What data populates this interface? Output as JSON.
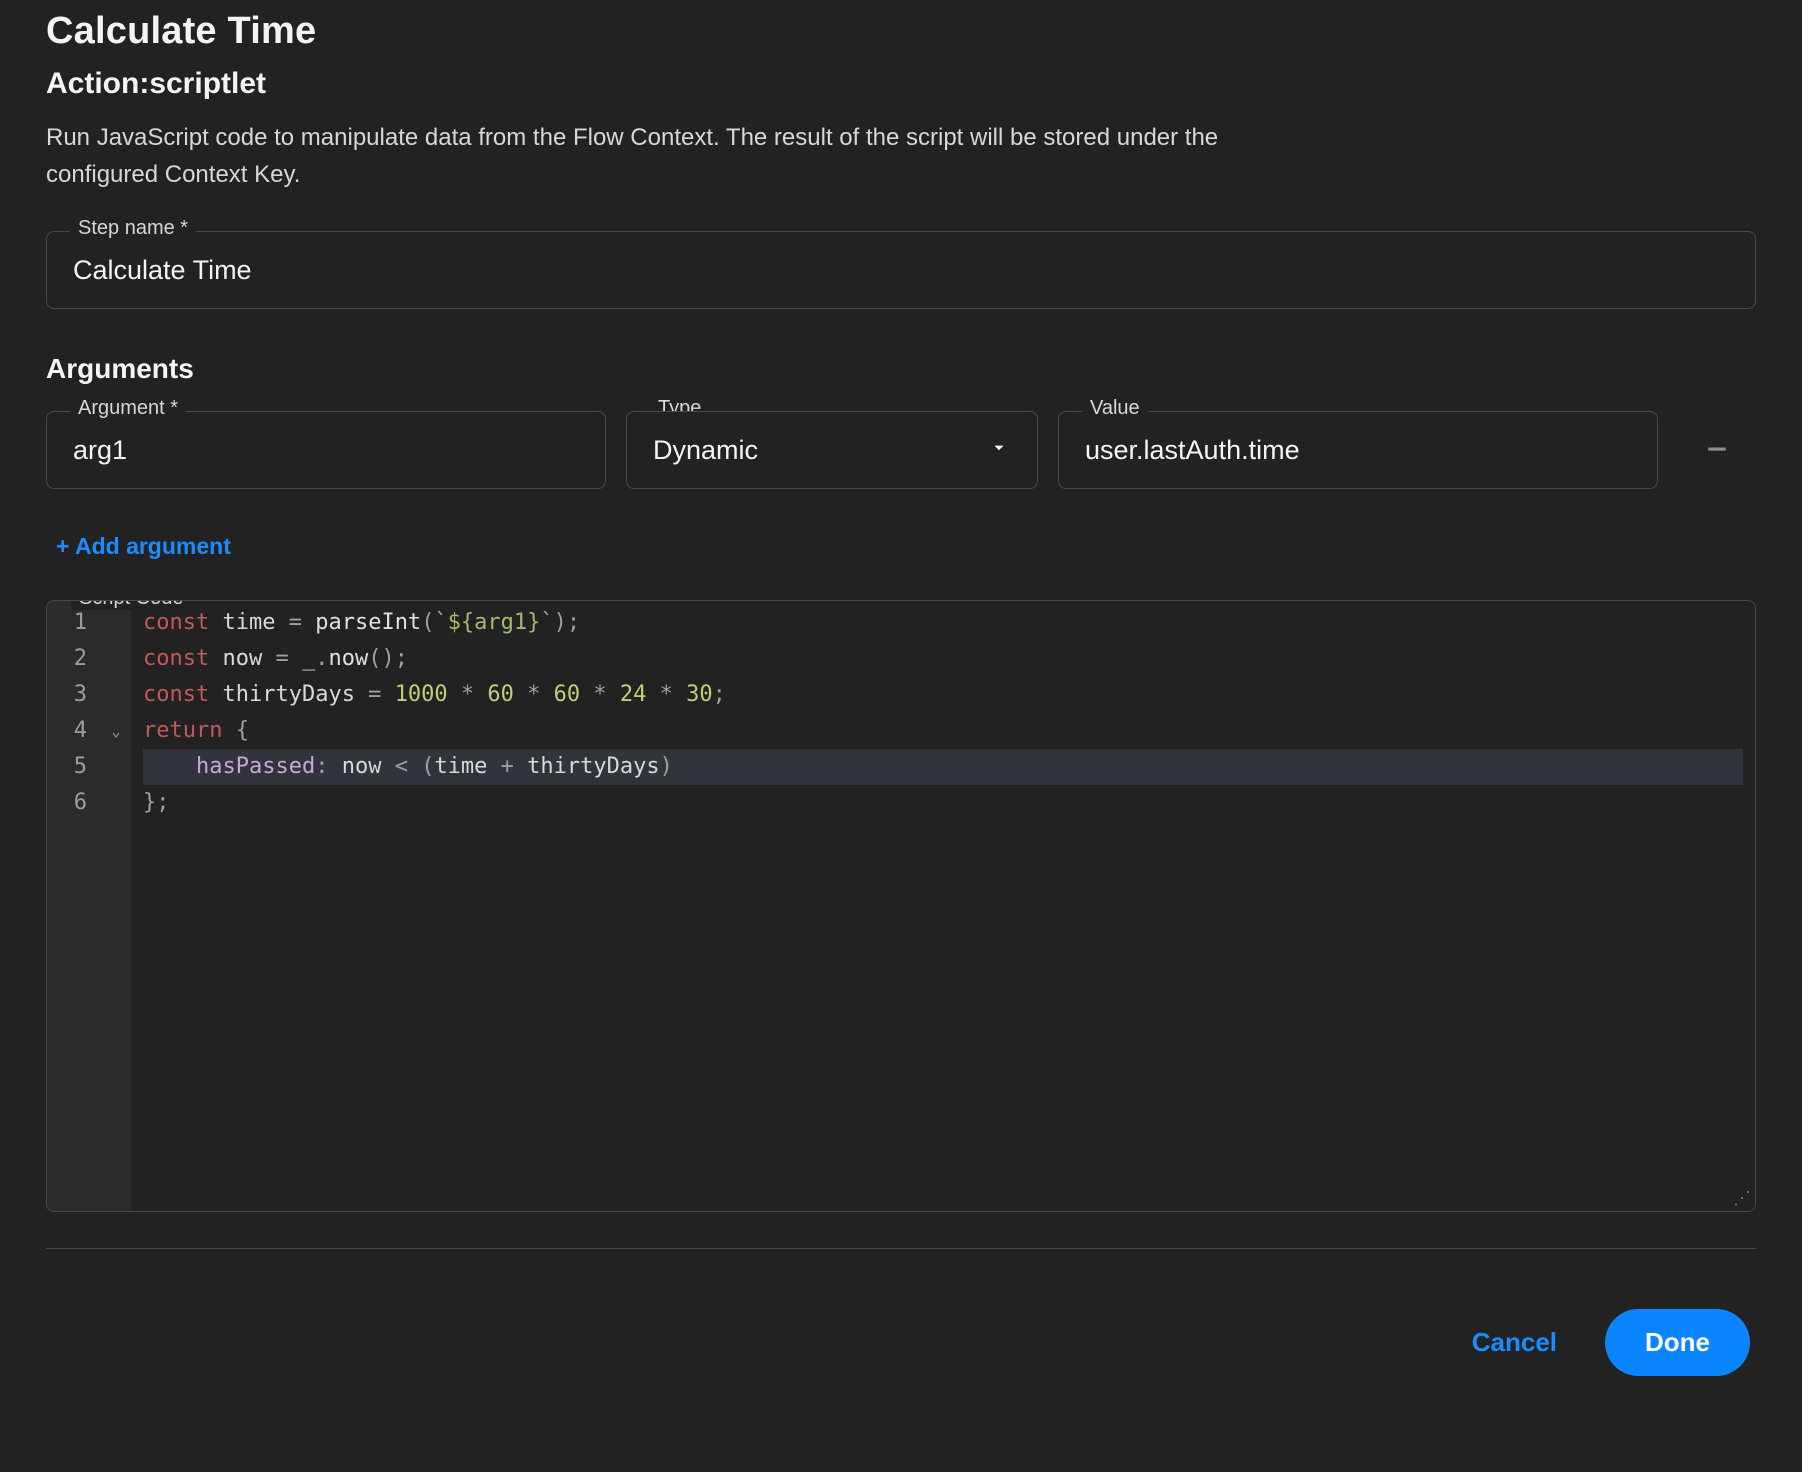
{
  "header": {
    "title": "Calculate Time",
    "subtitle": "Action:scriptlet",
    "description": "Run JavaScript code to manipulate data from the Flow Context. The result of the script will be stored under the configured Context Key."
  },
  "stepName": {
    "label": "Step name *",
    "value": "Calculate Time"
  },
  "arguments": {
    "heading": "Arguments",
    "rows": [
      {
        "argument_label": "Argument *",
        "argument_value": "arg1",
        "type_label": "Type",
        "type_value": "Dynamic",
        "value_label": "Value",
        "value_value": "user.lastAuth.time"
      }
    ],
    "add_label": "+ Add argument"
  },
  "script": {
    "label": "Script Code",
    "gutter": [
      "1",
      "2",
      "3",
      "4",
      "5",
      "6"
    ],
    "fold_row": 4,
    "highlighted_row": 5,
    "lines": [
      {
        "tokens": [
          {
            "t": "kw",
            "s": "const"
          },
          {
            "t": "pu",
            "s": " "
          },
          {
            "t": "va",
            "s": "time"
          },
          {
            "t": "pu",
            "s": " = "
          },
          {
            "t": "fn",
            "s": "parseInt"
          },
          {
            "t": "pu",
            "s": "("
          },
          {
            "t": "st",
            "s": "`${arg1}`"
          },
          {
            "t": "pu",
            "s": ");"
          }
        ]
      },
      {
        "tokens": [
          {
            "t": "kw",
            "s": "const"
          },
          {
            "t": "pu",
            "s": " "
          },
          {
            "t": "va",
            "s": "now"
          },
          {
            "t": "pu",
            "s": " = "
          },
          {
            "t": "va",
            "s": "_"
          },
          {
            "t": "pu",
            "s": "."
          },
          {
            "t": "fn",
            "s": "now"
          },
          {
            "t": "pu",
            "s": "();"
          }
        ]
      },
      {
        "tokens": [
          {
            "t": "kw",
            "s": "const"
          },
          {
            "t": "pu",
            "s": " "
          },
          {
            "t": "va",
            "s": "thirtyDays"
          },
          {
            "t": "pu",
            "s": " = "
          },
          {
            "t": "nu",
            "s": "1000"
          },
          {
            "t": "pu",
            "s": " * "
          },
          {
            "t": "nu",
            "s": "60"
          },
          {
            "t": "pu",
            "s": " * "
          },
          {
            "t": "nu",
            "s": "60"
          },
          {
            "t": "pu",
            "s": " * "
          },
          {
            "t": "nu",
            "s": "24"
          },
          {
            "t": "pu",
            "s": " * "
          },
          {
            "t": "nu",
            "s": "30"
          },
          {
            "t": "pu",
            "s": ";"
          }
        ]
      },
      {
        "tokens": [
          {
            "t": "kw",
            "s": "return"
          },
          {
            "t": "pu",
            "s": " {"
          }
        ]
      },
      {
        "tokens": [
          {
            "t": "pu",
            "s": "    "
          },
          {
            "t": "pr",
            "s": "hasPassed"
          },
          {
            "t": "pu",
            "s": ": "
          },
          {
            "t": "va",
            "s": "now"
          },
          {
            "t": "pu",
            "s": " < ("
          },
          {
            "t": "va",
            "s": "time"
          },
          {
            "t": "pu",
            "s": " + "
          },
          {
            "t": "va",
            "s": "thirtyDays"
          },
          {
            "t": "pu",
            "s": ")"
          }
        ]
      },
      {
        "tokens": [
          {
            "t": "pu",
            "s": "};"
          }
        ]
      }
    ]
  },
  "footer": {
    "cancel": "Cancel",
    "done": "Done"
  }
}
